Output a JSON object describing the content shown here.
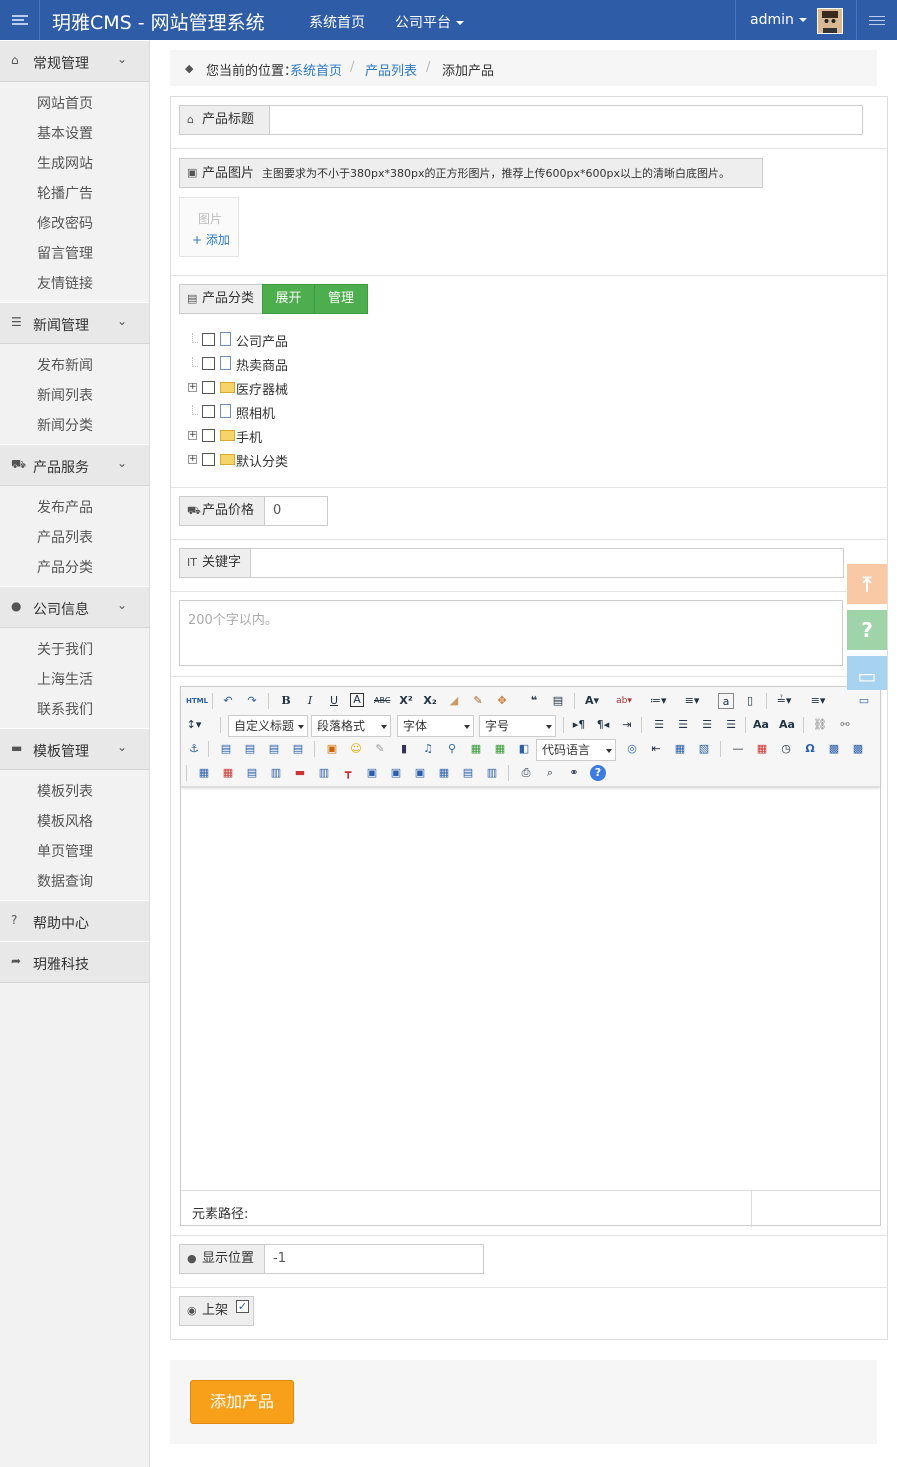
{
  "header": {
    "brand": "玥雅CMS - 网站管理系统",
    "nav_home": "系统首页",
    "nav_company": "公司平台",
    "user_name": "admin"
  },
  "sidebar": {
    "groups": [
      {
        "label": "常规管理",
        "icon": "home-icon",
        "items": [
          "网站首页",
          "基本设置",
          "生成网站",
          "轮播广告",
          "修改密码",
          "留言管理",
          "友情链接"
        ]
      },
      {
        "label": "新闻管理",
        "icon": "list-icon",
        "items": [
          "发布新闻",
          "新闻列表",
          "新闻分类"
        ]
      },
      {
        "label": "产品服务",
        "icon": "cart-icon",
        "items": [
          "发布产品",
          "产品列表",
          "产品分类"
        ]
      },
      {
        "label": "公司信息",
        "icon": "globe-icon",
        "items": [
          "关于我们",
          "上海生活",
          "联系我们"
        ]
      },
      {
        "label": "模板管理",
        "icon": "laptop-icon",
        "items": [
          "模板列表",
          "模板风格",
          "单页管理",
          "数据查询"
        ]
      },
      {
        "label": "帮助中心",
        "icon": "question-icon",
        "items": []
      },
      {
        "label": "玥雅科技",
        "icon": "share-icon",
        "items": []
      }
    ]
  },
  "breadcrumb": {
    "prefix": "您当前的位置：",
    "home": "系统首页",
    "list": "产品列表",
    "current": "添加产品",
    "separator": "/"
  },
  "form": {
    "title_label": "产品标题",
    "title_value": "",
    "image_label": "产品图片",
    "image_hint": "主图要求为不小于380px*380px的正方形图片，推荐上传600px*600px以上的清晰白底图片。",
    "image_placeholder": "图片",
    "image_add": "+ 添加",
    "category_label": "产品分类",
    "expand_button": "展开",
    "manage_button": "管理",
    "categories": [
      {
        "label": "公司产品",
        "type": "file",
        "expandable": false
      },
      {
        "label": "热卖商品",
        "type": "file",
        "expandable": false
      },
      {
        "label": "医疗器械",
        "type": "folder",
        "expandable": true
      },
      {
        "label": "照相机",
        "type": "file",
        "expandable": false
      },
      {
        "label": "手机",
        "type": "folder",
        "expandable": true
      },
      {
        "label": "默认分类",
        "type": "folder",
        "expandable": true
      }
    ],
    "price_label": "产品价格",
    "price_value": "0",
    "keyword_label": "关键字",
    "keyword_value": "",
    "description_placeholder": "200个字以内。",
    "editor": {
      "html_button": "HTML",
      "heading_select": "自定义标题",
      "paragraph_select": "段落格式",
      "font_select": "字体",
      "size_select": "字号",
      "code_select": "代码语言",
      "path_label": "元素路径:"
    },
    "position_label": "显示位置",
    "position_value": "-1",
    "publish_label": "上架",
    "publish_checked": true,
    "submit_button": "添加产品"
  },
  "colors": {
    "header": "#2f5ca6",
    "green": "#4cae4c",
    "submit": "#f9a01b",
    "link": "#2a7ac4"
  }
}
